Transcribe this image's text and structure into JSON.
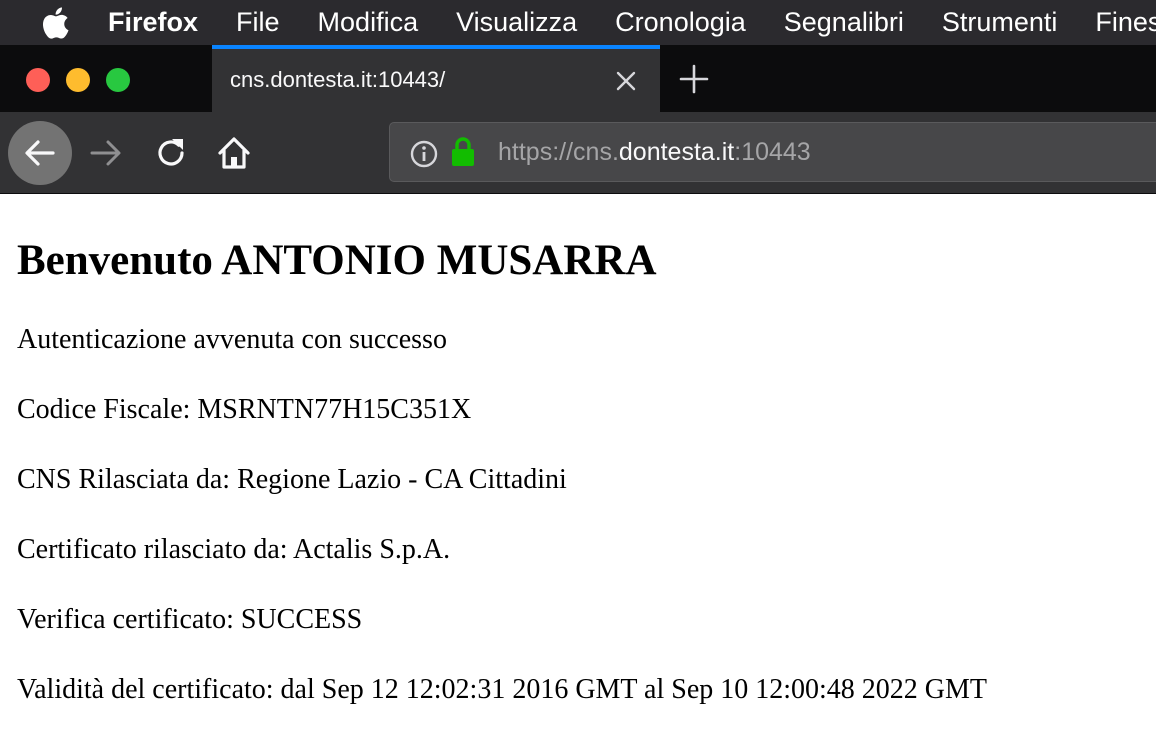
{
  "menubar": {
    "app_name": "Firefox",
    "items": [
      "File",
      "Modifica",
      "Visualizza",
      "Cronologia",
      "Segnalibri",
      "Strumenti",
      "Finestra"
    ]
  },
  "tab": {
    "title": "cns.dontesta.it:10443/"
  },
  "urlbar": {
    "scheme": "https://cns.",
    "domain": "dontesta.it",
    "port": ":10443"
  },
  "page": {
    "heading": "Benvenuto ANTONIO MUSARRA",
    "lines": [
      "Autenticazione avvenuta con successo",
      "Codice Fiscale: MSRNTN77H15C351X",
      "CNS Rilasciata da: Regione Lazio - CA Cittadini",
      "Certificato rilasciato da: Actalis S.p.A.",
      "Verifica certificato: SUCCESS",
      "Validità del certificato: dal Sep 12 12:02:31 2016 GMT al Sep 10 12:00:48 2022 GMT"
    ]
  },
  "colors": {
    "tab_accent": "#0a84ff",
    "lock": "#12bc00"
  }
}
